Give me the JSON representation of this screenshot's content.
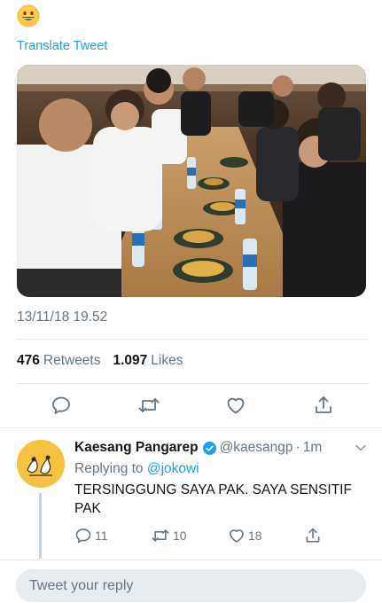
{
  "tweet": {
    "emoji_icon": "grinning-face-emoji",
    "translate_label": "Translate Tweet",
    "media_icon": "photo-of-group-dining-at-long-table",
    "timestamp": "13/11/18 19.52",
    "retweets_count": "476",
    "retweets_label": "Retweets",
    "likes_count": "1.097",
    "likes_label": "Likes",
    "actions": [
      "reply-icon",
      "retweet-icon",
      "like-icon",
      "share-icon"
    ]
  },
  "reply": {
    "avatar_icon": "illustrated-avatar",
    "name": "Kaesang Pangarep",
    "verified_icon": "verified-badge-icon",
    "handle": "@kaesangp",
    "separator": "·",
    "time": "1m",
    "replying_prefix": "Replying to",
    "replying_to": "@jokowi",
    "text": "TERSINGGUNG SAYA PAK. SAYA SENSITIF PAK",
    "reply_count": "11",
    "retweet_count": "10",
    "like_count": "18"
  },
  "composer": {
    "placeholder": "Tweet your reply"
  },
  "colors": {
    "accent": "#1da1f2",
    "secondary_text": "#657786",
    "divider": "#e1e8ed",
    "composer_bg": "#e6ecf0"
  }
}
